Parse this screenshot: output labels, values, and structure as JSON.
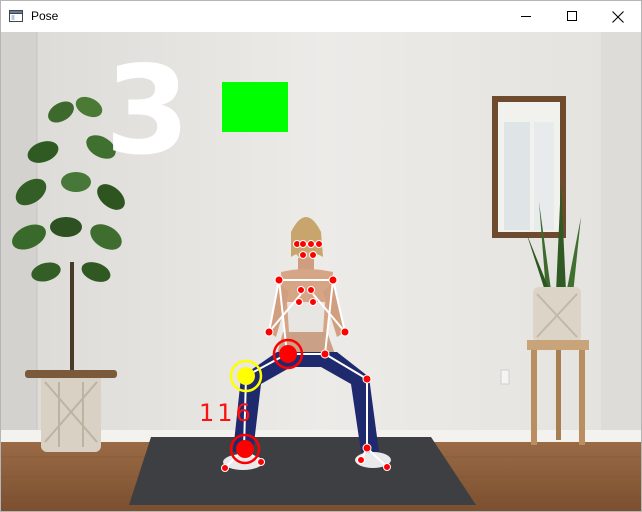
{
  "window": {
    "title": "Pose",
    "controls": [
      "minimize",
      "maximize",
      "close"
    ]
  },
  "overlay": {
    "rep_count": "3",
    "angle_readout": "116",
    "status_color": "#00ff00",
    "keypoint_color": "#ff0000",
    "active_joint_color": "#ffff00",
    "skeleton_color": "#ffffff"
  }
}
